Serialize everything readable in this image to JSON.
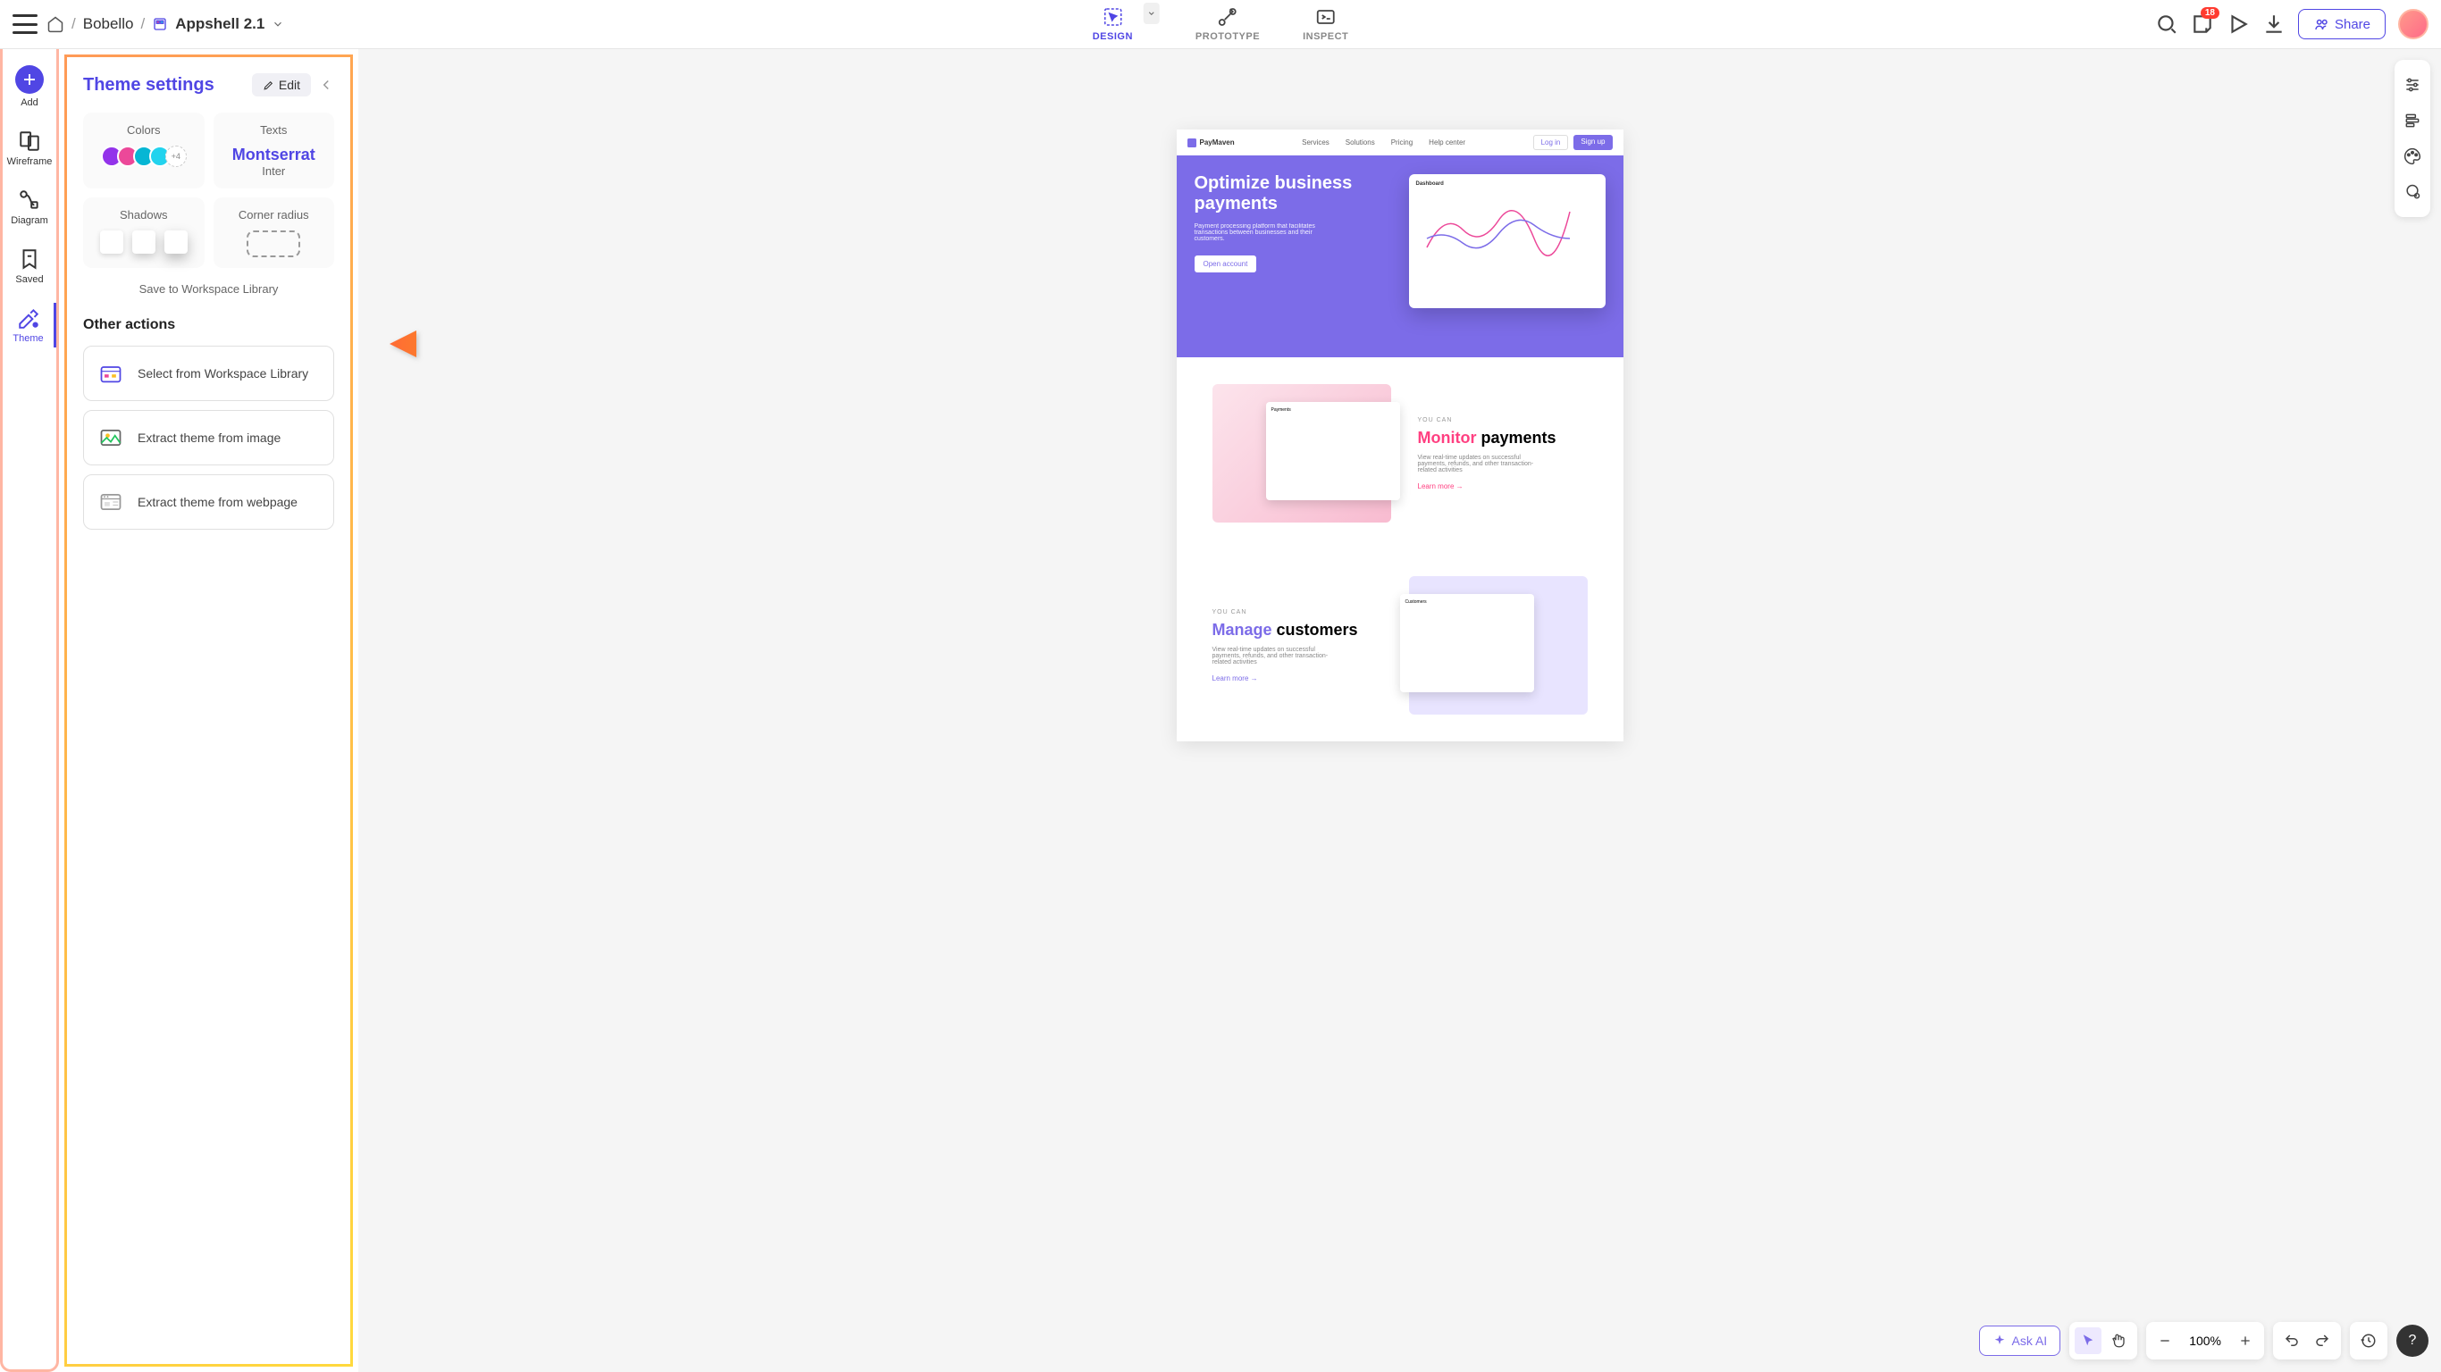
{
  "header": {
    "breadcrumb": {
      "workspace": "Bobello",
      "file": "Appshell 2.1"
    },
    "modes": {
      "design": "DESIGN",
      "prototype": "PROTOTYPE",
      "inspect": "INSPECT"
    },
    "notification_count": "18",
    "share_label": "Share"
  },
  "sidebar": {
    "items": [
      {
        "label": "Add"
      },
      {
        "label": "Wireframe"
      },
      {
        "label": "Diagram"
      },
      {
        "label": "Saved"
      },
      {
        "label": "Theme"
      }
    ]
  },
  "panel": {
    "title": "Theme settings",
    "edit_label": "Edit",
    "cards": {
      "colors_label": "Colors",
      "colors_more": "+4",
      "texts_label": "Texts",
      "font_primary": "Montserrat",
      "font_secondary": "Inter",
      "shadows_label": "Shadows",
      "radius_label": "Corner radius"
    },
    "save_link": "Save to Workspace Library",
    "other_title": "Other actions",
    "actions": [
      {
        "label": "Select from Workspace Library"
      },
      {
        "label": "Extract theme from image"
      },
      {
        "label": "Extract theme from webpage"
      }
    ]
  },
  "mockup": {
    "brand": "PayMaven",
    "nav": [
      "Services",
      "Solutions",
      "Pricing",
      "Help center"
    ],
    "login": "Log in",
    "signup": "Sign up",
    "hero_title": "Optimize business payments",
    "hero_desc": "Payment processing platform that facilitates transactions between businesses and their customers.",
    "hero_btn": "Open account",
    "eyebrow": "YOU CAN",
    "section1_pink": "Monitor",
    "section1_rest": " payments",
    "section1_desc": "View real-time updates on successful payments, refunds, and other transaction-related activities",
    "section2_purple": "Manage",
    "section2_rest": " customers",
    "section2_desc": "View real-time updates on successful payments, refunds, and other transaction-related activities",
    "learn_more": "Learn more →"
  },
  "bottom": {
    "ask_ai": "Ask AI",
    "zoom": "100%",
    "help": "?"
  },
  "colors": {
    "swatch1": "#9333ea",
    "swatch2": "#ec4899",
    "swatch3": "#06b6d4",
    "swatch4": "#22d3ee"
  }
}
